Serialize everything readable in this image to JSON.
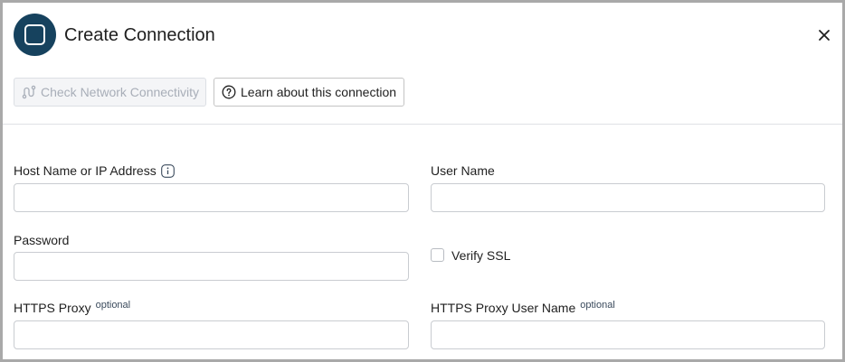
{
  "dialog": {
    "title": "Create Connection",
    "logo_icon": "square-app-logo-icon",
    "close_icon": "close-icon",
    "accent_color": "#16425e"
  },
  "toolbar": {
    "check_connectivity_label": "Check Network Connectivity",
    "check_connectivity_icon": "network-path-icon",
    "check_connectivity_enabled": false,
    "learn_label": "Learn about this connection",
    "learn_icon": "question-circle-icon"
  },
  "form": {
    "host": {
      "label": "Host Name or IP Address",
      "value": "",
      "info_icon": "info-icon"
    },
    "user_name": {
      "label": "User Name",
      "value": ""
    },
    "password": {
      "label": "Password",
      "value": ""
    },
    "verify_ssl": {
      "label": "Verify SSL",
      "checked": false
    },
    "https_proxy": {
      "label": "HTTPS Proxy",
      "optional": "optional",
      "value": ""
    },
    "https_proxy_user": {
      "label": "HTTPS Proxy User Name",
      "optional": "optional",
      "value": ""
    }
  }
}
